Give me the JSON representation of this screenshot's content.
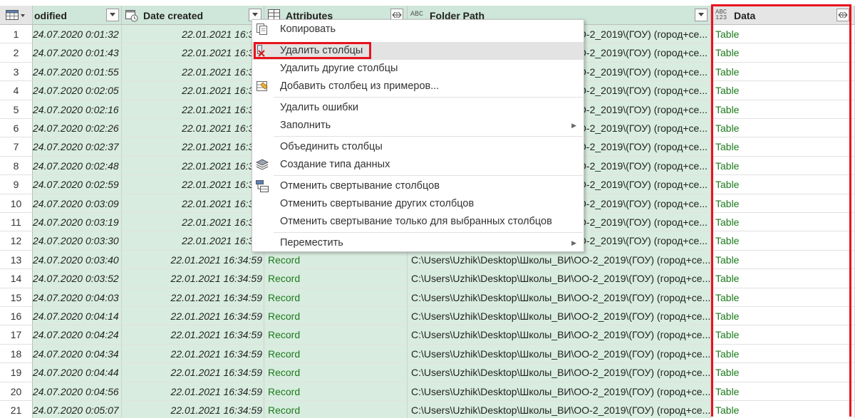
{
  "columns": {
    "modified": "odified",
    "date_created": "Date created",
    "attributes": "Attributes",
    "attributes_type": "",
    "folder_path": "Folder Path",
    "folder_path_type": "ABC",
    "data": "Data",
    "data_type_top": "ABC",
    "data_type_bottom": "123"
  },
  "rows": [
    {
      "n": "1",
      "modified": "24.07.2020 0:01:32",
      "created": "22.01.2021 16:34:",
      "attr": "",
      "path": "OO-2_2019\\(ГОУ) (город+се...",
      "data": "Table"
    },
    {
      "n": "2",
      "modified": "24.07.2020 0:01:43",
      "created": "22.01.2021 16:34:",
      "attr": "",
      "path": "OO-2_2019\\(ГОУ) (город+се...",
      "data": "Table"
    },
    {
      "n": "3",
      "modified": "24.07.2020 0:01:55",
      "created": "22.01.2021 16:34:",
      "attr": "",
      "path": "OO-2_2019\\(ГОУ) (город+се...",
      "data": "Table"
    },
    {
      "n": "4",
      "modified": "24.07.2020 0:02:05",
      "created": "22.01.2021 16:34:",
      "attr": "",
      "path": "OO-2_2019\\(ГОУ) (город+се...",
      "data": "Table"
    },
    {
      "n": "5",
      "modified": "24.07.2020 0:02:16",
      "created": "22.01.2021 16:34:",
      "attr": "",
      "path": "OO-2_2019\\(ГОУ) (город+се...",
      "data": "Table"
    },
    {
      "n": "6",
      "modified": "24.07.2020 0:02:26",
      "created": "22.01.2021 16:34:",
      "attr": "",
      "path": "OO-2_2019\\(ГОУ) (город+се...",
      "data": "Table"
    },
    {
      "n": "7",
      "modified": "24.07.2020 0:02:37",
      "created": "22.01.2021 16:34:",
      "attr": "",
      "path": "OO-2_2019\\(ГОУ) (город+се...",
      "data": "Table"
    },
    {
      "n": "8",
      "modified": "24.07.2020 0:02:48",
      "created": "22.01.2021 16:34:",
      "attr": "",
      "path": "OO-2_2019\\(ГОУ) (город+се...",
      "data": "Table"
    },
    {
      "n": "9",
      "modified": "24.07.2020 0:02:59",
      "created": "22.01.2021 16:34:",
      "attr": "",
      "path": "OO-2_2019\\(ГОУ) (город+се...",
      "data": "Table"
    },
    {
      "n": "10",
      "modified": "24.07.2020 0:03:09",
      "created": "22.01.2021 16:34:",
      "attr": "",
      "path": "OO-2_2019\\(ГОУ) (город+се...",
      "data": "Table"
    },
    {
      "n": "11",
      "modified": "24.07.2020 0:03:19",
      "created": "22.01.2021 16:34:",
      "attr": "",
      "path": "OO-2_2019\\(ГОУ) (город+се...",
      "data": "Table"
    },
    {
      "n": "12",
      "modified": "24.07.2020 0:03:30",
      "created": "22.01.2021 16:34:",
      "attr": "",
      "path": "OO-2_2019\\(ГОУ) (город+се...",
      "data": "Table"
    },
    {
      "n": "13",
      "modified": "24.07.2020 0:03:40",
      "created": "22.01.2021 16:34:59",
      "attr": "Record",
      "path": "C:\\Users\\Uzhik\\Desktop\\Школы_ВИ\\OO-2_2019\\(ГОУ) (город+се...",
      "data": "Table"
    },
    {
      "n": "14",
      "modified": "24.07.2020 0:03:52",
      "created": "22.01.2021 16:34:59",
      "attr": "Record",
      "path": "C:\\Users\\Uzhik\\Desktop\\Школы_ВИ\\OO-2_2019\\(ГОУ) (город+се...",
      "data": "Table"
    },
    {
      "n": "15",
      "modified": "24.07.2020 0:04:03",
      "created": "22.01.2021 16:34:59",
      "attr": "Record",
      "path": "C:\\Users\\Uzhik\\Desktop\\Школы_ВИ\\OO-2_2019\\(ГОУ) (город+се...",
      "data": "Table"
    },
    {
      "n": "16",
      "modified": "24.07.2020 0:04:14",
      "created": "22.01.2021 16:34:59",
      "attr": "Record",
      "path": "C:\\Users\\Uzhik\\Desktop\\Школы_ВИ\\OO-2_2019\\(ГОУ) (город+се...",
      "data": "Table"
    },
    {
      "n": "17",
      "modified": "24.07.2020 0:04:24",
      "created": "22.01.2021 16:34:59",
      "attr": "Record",
      "path": "C:\\Users\\Uzhik\\Desktop\\Школы_ВИ\\OO-2_2019\\(ГОУ) (город+се...",
      "data": "Table"
    },
    {
      "n": "18",
      "modified": "24.07.2020 0:04:34",
      "created": "22.01.2021 16:34:59",
      "attr": "Record",
      "path": "C:\\Users\\Uzhik\\Desktop\\Школы_ВИ\\OO-2_2019\\(ГОУ) (город+се...",
      "data": "Table"
    },
    {
      "n": "19",
      "modified": "24.07.2020 0:04:44",
      "created": "22.01.2021 16:34:59",
      "attr": "Record",
      "path": "C:\\Users\\Uzhik\\Desktop\\Школы_ВИ\\OO-2_2019\\(ГОУ) (город+се...",
      "data": "Table"
    },
    {
      "n": "20",
      "modified": "24.07.2020 0:04:56",
      "created": "22.01.2021 16:34:59",
      "attr": "Record",
      "path": "C:\\Users\\Uzhik\\Desktop\\Школы_ВИ\\OO-2_2019\\(ГОУ) (город+се...",
      "data": "Table"
    },
    {
      "n": "21",
      "modified": "24.07.2020 0:05:07",
      "created": "22.01.2021 16:34:59",
      "attr": "Record",
      "path": "C:\\Users\\Uzhik\\Desktop\\Школы_ВИ\\OO-2_2019\\(ГОУ) (город+се...",
      "data": "Table"
    }
  ],
  "context_menu": {
    "items": [
      {
        "label": "Копировать",
        "icon": "copy-icon"
      },
      {
        "label": "Удалить столбцы",
        "icon": "delete-columns-icon"
      },
      {
        "label": "Удалить другие столбцы",
        "icon": ""
      },
      {
        "label": "Добавить столбец из примеров...",
        "icon": "column-from-examples-icon"
      },
      {
        "label": "Удалить ошибки",
        "icon": ""
      },
      {
        "label": "Заполнить",
        "icon": ""
      },
      {
        "label": "Объединить столбцы",
        "icon": ""
      },
      {
        "label": "Создание типа данных",
        "icon": "data-type-icon"
      },
      {
        "label": "Отменить свертывание столбцов",
        "icon": "unpivot-icon"
      },
      {
        "label": "Отменить свертывание других столбцов",
        "icon": ""
      },
      {
        "label": "Отменить свертывание только для выбранных столбцов",
        "icon": ""
      },
      {
        "label": "Переместить",
        "icon": ""
      }
    ]
  },
  "colors": {
    "selected_column_bg": "#d8ecdf",
    "value_green": "#1c7a1c",
    "highlight_red": "#e8121d"
  }
}
